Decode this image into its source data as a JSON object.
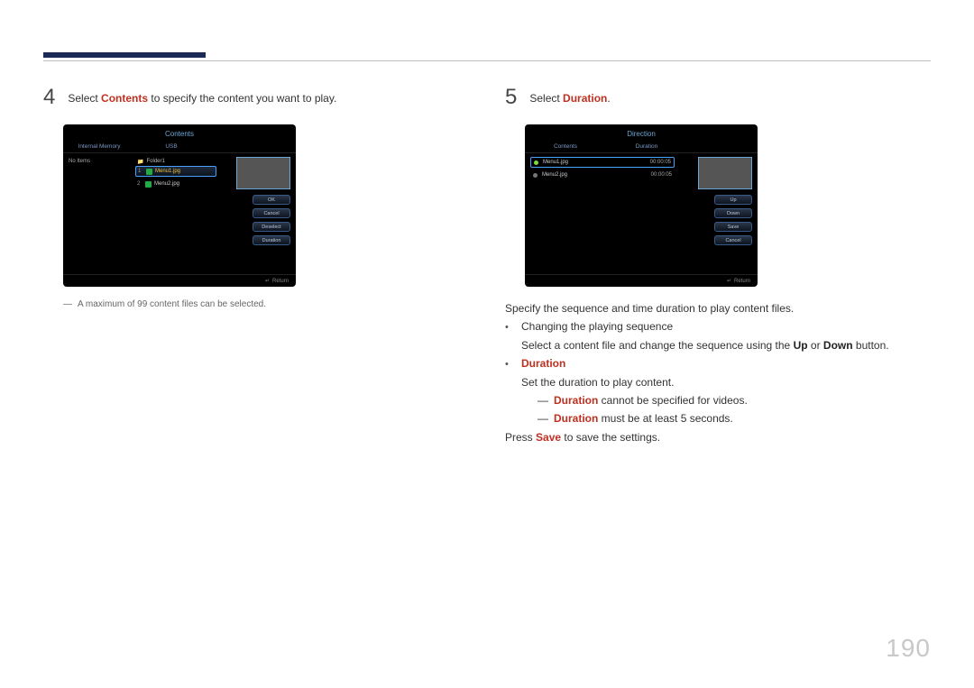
{
  "page_number": "190",
  "step4": {
    "num": "4",
    "text_pre": "Select ",
    "text_kw": "Contents",
    "text_post": " to specify the content you want to play.",
    "screen": {
      "title": "Contents",
      "tabs": {
        "left": "Internal Memory",
        "right": "USB"
      },
      "left_label": "No Items",
      "folder": "Folder1",
      "files": [
        {
          "idx": "1",
          "name": "Menu1.jpg",
          "selected": true
        },
        {
          "idx": "2",
          "name": "Menu2.jpg",
          "selected": false
        }
      ],
      "buttons": [
        "OK",
        "Cancel",
        "Deselect",
        "Duration"
      ],
      "return": "Return"
    },
    "note": "A maximum of 99 content files can be selected."
  },
  "step5": {
    "num": "5",
    "text_pre": "Select ",
    "text_kw": "Duration",
    "text_post": ".",
    "screen": {
      "title": "Direction",
      "tabs": {
        "left": "Contents",
        "right": "Duration"
      },
      "rows": [
        {
          "name": "Menu1.jpg",
          "dur": "00:00:05",
          "hl": true,
          "green": true
        },
        {
          "name": "Menu2.jpg",
          "dur": "00:00:05",
          "hl": false,
          "green": false
        }
      ],
      "buttons": [
        "Up",
        "Down",
        "Save",
        "Cancel"
      ],
      "return": "Return"
    },
    "explain": {
      "intro": "Specify the sequence and time duration to play content files.",
      "seq_title": "Changing the playing sequence",
      "seq_body_pre": "Select a content file and change the sequence using the ",
      "seq_kw1": "Up",
      "seq_mid": " or ",
      "seq_kw2": "Down",
      "seq_body_post": " button.",
      "duration_kw": "Duration",
      "duration_body": "Set the duration to play content.",
      "sub1_kw": "Duration",
      "sub1_post": " cannot be specified for videos.",
      "sub2_kw": "Duration",
      "sub2_post": " must be at least 5 seconds.",
      "save_pre": "Press ",
      "save_kw": "Save",
      "save_post": " to save the settings."
    }
  }
}
